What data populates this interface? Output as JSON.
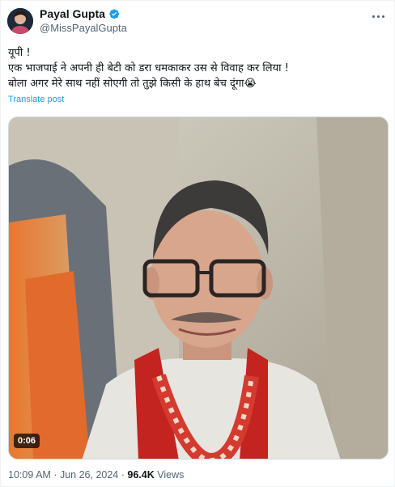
{
  "author": {
    "display_name": "Payal Gupta",
    "handle": "@MissPayalGupta",
    "verified": true,
    "verified_color": "#1d9bf0"
  },
  "tweet": {
    "lines": [
      "यूपी !",
      "एक भाजपाई ने अपनी ही बेटी को डरा धमकाकर उस से विवाह कर लिया !",
      "बोला अगर मेरे साथ नहीं सोएगी तो तुझे किसी के हाथ बेच दूंगा😭"
    ],
    "translate_label": "Translate post"
  },
  "video": {
    "duration": "0:06"
  },
  "meta": {
    "time": "10:09 AM",
    "separator": "·",
    "date": "Jun 26, 2024",
    "views_count": "96.4K",
    "views_label": "Views"
  },
  "colors": {
    "accent": "#1d9bf0",
    "secondary_text": "#536471",
    "primary_text": "#0f1419"
  },
  "icons": {
    "verified": "verified-badge-icon",
    "more": "more-options-icon"
  }
}
